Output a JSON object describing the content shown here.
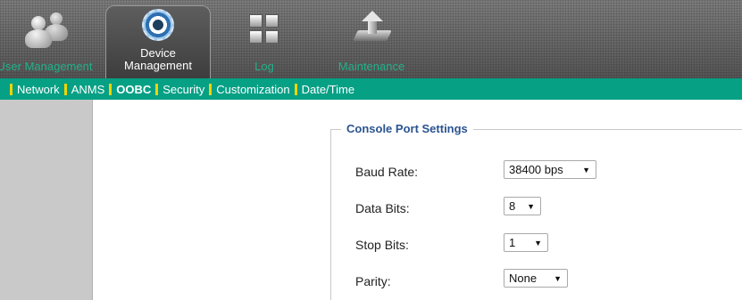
{
  "top_nav": [
    {
      "label": "User Management",
      "icon": "users-icon"
    },
    {
      "label": "Device Management",
      "icon": "gear-icon",
      "active": true
    },
    {
      "label": "Log",
      "icon": "log-icon"
    },
    {
      "label": "Maintenance",
      "icon": "maintenance-icon"
    }
  ],
  "sub_nav": {
    "items": [
      "Network",
      "ANMS",
      "OOBC",
      "Security",
      "Customization",
      "Date/Time"
    ],
    "active": "OOBC"
  },
  "console_port": {
    "legend": "Console Port Settings",
    "baud_rate": {
      "label": "Baud Rate:",
      "value": "38400 bps"
    },
    "data_bits": {
      "label": "Data Bits:",
      "value": "8"
    },
    "stop_bits": {
      "label": "Stop Bits:",
      "value": "1"
    },
    "parity": {
      "label": "Parity:",
      "value": "None"
    }
  },
  "colors": {
    "subnav_bg": "#06a085",
    "separator": "#f0d400",
    "inactive_nav_text": "#22b089",
    "legend_text": "#2a5390"
  }
}
